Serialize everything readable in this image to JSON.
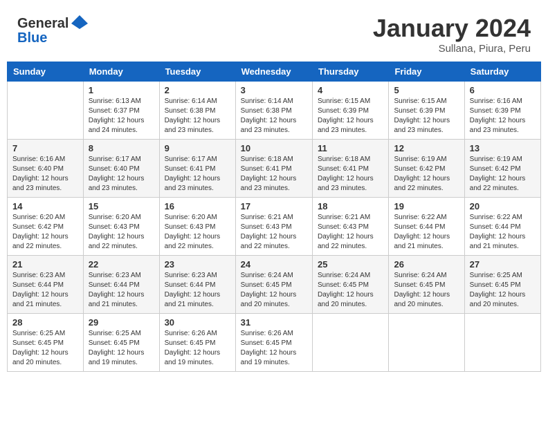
{
  "logo": {
    "general": "General",
    "blue": "Blue"
  },
  "header": {
    "month_year": "January 2024",
    "location": "Sullana, Piura, Peru"
  },
  "weekdays": [
    "Sunday",
    "Monday",
    "Tuesday",
    "Wednesday",
    "Thursday",
    "Friday",
    "Saturday"
  ],
  "weeks": [
    [
      {
        "day": "",
        "info": ""
      },
      {
        "day": "1",
        "info": "Sunrise: 6:13 AM\nSunset: 6:37 PM\nDaylight: 12 hours\nand 24 minutes."
      },
      {
        "day": "2",
        "info": "Sunrise: 6:14 AM\nSunset: 6:38 PM\nDaylight: 12 hours\nand 23 minutes."
      },
      {
        "day": "3",
        "info": "Sunrise: 6:14 AM\nSunset: 6:38 PM\nDaylight: 12 hours\nand 23 minutes."
      },
      {
        "day": "4",
        "info": "Sunrise: 6:15 AM\nSunset: 6:39 PM\nDaylight: 12 hours\nand 23 minutes."
      },
      {
        "day": "5",
        "info": "Sunrise: 6:15 AM\nSunset: 6:39 PM\nDaylight: 12 hours\nand 23 minutes."
      },
      {
        "day": "6",
        "info": "Sunrise: 6:16 AM\nSunset: 6:39 PM\nDaylight: 12 hours\nand 23 minutes."
      }
    ],
    [
      {
        "day": "7",
        "info": "Sunrise: 6:16 AM\nSunset: 6:40 PM\nDaylight: 12 hours\nand 23 minutes."
      },
      {
        "day": "8",
        "info": "Sunrise: 6:17 AM\nSunset: 6:40 PM\nDaylight: 12 hours\nand 23 minutes."
      },
      {
        "day": "9",
        "info": "Sunrise: 6:17 AM\nSunset: 6:41 PM\nDaylight: 12 hours\nand 23 minutes."
      },
      {
        "day": "10",
        "info": "Sunrise: 6:18 AM\nSunset: 6:41 PM\nDaylight: 12 hours\nand 23 minutes."
      },
      {
        "day": "11",
        "info": "Sunrise: 6:18 AM\nSunset: 6:41 PM\nDaylight: 12 hours\nand 23 minutes."
      },
      {
        "day": "12",
        "info": "Sunrise: 6:19 AM\nSunset: 6:42 PM\nDaylight: 12 hours\nand 22 minutes."
      },
      {
        "day": "13",
        "info": "Sunrise: 6:19 AM\nSunset: 6:42 PM\nDaylight: 12 hours\nand 22 minutes."
      }
    ],
    [
      {
        "day": "14",
        "info": "Sunrise: 6:20 AM\nSunset: 6:42 PM\nDaylight: 12 hours\nand 22 minutes."
      },
      {
        "day": "15",
        "info": "Sunrise: 6:20 AM\nSunset: 6:43 PM\nDaylight: 12 hours\nand 22 minutes."
      },
      {
        "day": "16",
        "info": "Sunrise: 6:20 AM\nSunset: 6:43 PM\nDaylight: 12 hours\nand 22 minutes."
      },
      {
        "day": "17",
        "info": "Sunrise: 6:21 AM\nSunset: 6:43 PM\nDaylight: 12 hours\nand 22 minutes."
      },
      {
        "day": "18",
        "info": "Sunrise: 6:21 AM\nSunset: 6:43 PM\nDaylight: 12 hours\nand 22 minutes."
      },
      {
        "day": "19",
        "info": "Sunrise: 6:22 AM\nSunset: 6:44 PM\nDaylight: 12 hours\nand 21 minutes."
      },
      {
        "day": "20",
        "info": "Sunrise: 6:22 AM\nSunset: 6:44 PM\nDaylight: 12 hours\nand 21 minutes."
      }
    ],
    [
      {
        "day": "21",
        "info": "Sunrise: 6:23 AM\nSunset: 6:44 PM\nDaylight: 12 hours\nand 21 minutes."
      },
      {
        "day": "22",
        "info": "Sunrise: 6:23 AM\nSunset: 6:44 PM\nDaylight: 12 hours\nand 21 minutes."
      },
      {
        "day": "23",
        "info": "Sunrise: 6:23 AM\nSunset: 6:44 PM\nDaylight: 12 hours\nand 21 minutes."
      },
      {
        "day": "24",
        "info": "Sunrise: 6:24 AM\nSunset: 6:45 PM\nDaylight: 12 hours\nand 20 minutes."
      },
      {
        "day": "25",
        "info": "Sunrise: 6:24 AM\nSunset: 6:45 PM\nDaylight: 12 hours\nand 20 minutes."
      },
      {
        "day": "26",
        "info": "Sunrise: 6:24 AM\nSunset: 6:45 PM\nDaylight: 12 hours\nand 20 minutes."
      },
      {
        "day": "27",
        "info": "Sunrise: 6:25 AM\nSunset: 6:45 PM\nDaylight: 12 hours\nand 20 minutes."
      }
    ],
    [
      {
        "day": "28",
        "info": "Sunrise: 6:25 AM\nSunset: 6:45 PM\nDaylight: 12 hours\nand 20 minutes."
      },
      {
        "day": "29",
        "info": "Sunrise: 6:25 AM\nSunset: 6:45 PM\nDaylight: 12 hours\nand 19 minutes."
      },
      {
        "day": "30",
        "info": "Sunrise: 6:26 AM\nSunset: 6:45 PM\nDaylight: 12 hours\nand 19 minutes."
      },
      {
        "day": "31",
        "info": "Sunrise: 6:26 AM\nSunset: 6:45 PM\nDaylight: 12 hours\nand 19 minutes."
      },
      {
        "day": "",
        "info": ""
      },
      {
        "day": "",
        "info": ""
      },
      {
        "day": "",
        "info": ""
      }
    ]
  ]
}
